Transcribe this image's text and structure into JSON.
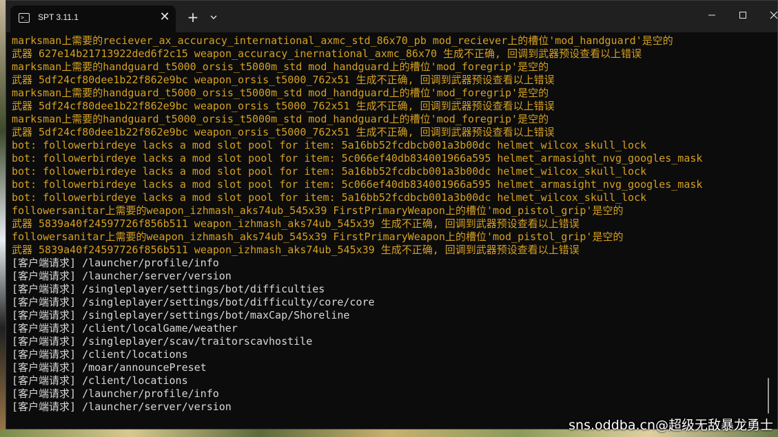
{
  "window": {
    "tab_title": "SPT 3.11.1",
    "tab_icon": "terminal-icon",
    "close_tab_label": "✕",
    "new_tab_label": "+"
  },
  "colors": {
    "warning": "#d6a022",
    "info": "#d8d8d8",
    "background": "#0c0c0c"
  },
  "console": {
    "lines": [
      {
        "type": "warn",
        "text": "marksman上需要的reciever_ax_accuracy_international_axmc_std_86x70_pb mod_reciever上的槽位'mod_handguard'是空的"
      },
      {
        "type": "warn",
        "text": "武器 627e14b21713922ded6f2c15 weapon_accuracy_inernational_axmc_86x70 生成不正确, 回调到武器预设查看以上错误"
      },
      {
        "type": "warn",
        "text": "marksman上需要的handguard_t5000_orsis_t5000m_std mod_handguard上的槽位'mod_foregrip'是空的"
      },
      {
        "type": "warn",
        "text": "武器 5df24cf80dee1b22f862e9bc weapon_orsis_t5000_762x51 生成不正确, 回调到武器预设查看以上错误"
      },
      {
        "type": "warn",
        "text": "marksman上需要的handguard_t5000_orsis_t5000m_std mod_handguard上的槽位'mod_foregrip'是空的"
      },
      {
        "type": "warn",
        "text": "武器 5df24cf80dee1b22f862e9bc weapon_orsis_t5000_762x51 生成不正确, 回调到武器预设查看以上错误"
      },
      {
        "type": "warn",
        "text": "marksman上需要的handguard_t5000_orsis_t5000m_std mod_handguard上的槽位'mod_foregrip'是空的"
      },
      {
        "type": "warn",
        "text": "武器 5df24cf80dee1b22f862e9bc weapon_orsis_t5000_762x51 生成不正确, 回调到武器预设查看以上错误"
      },
      {
        "type": "warn",
        "text": "bot: followerbirdeye lacks a mod slot pool for item: 5a16bb52fcdbcb001a3b00dc helmet_wilcox_skull_lock"
      },
      {
        "type": "warn",
        "text": "bot: followerbirdeye lacks a mod slot pool for item: 5c066ef40db834001966a595 helmet_armasight_nvg_googles_mask"
      },
      {
        "type": "warn",
        "text": "bot: followerbirdeye lacks a mod slot pool for item: 5a16bb52fcdbcb001a3b00dc helmet_wilcox_skull_lock"
      },
      {
        "type": "warn",
        "text": "bot: followerbirdeye lacks a mod slot pool for item: 5c066ef40db834001966a595 helmet_armasight_nvg_googles_mask"
      },
      {
        "type": "warn",
        "text": "bot: followerbirdeye lacks a mod slot pool for item: 5a16bb52fcdbcb001a3b00dc helmet_wilcox_skull_lock"
      },
      {
        "type": "warn",
        "text": "followersanitar上需要的weapon_izhmash_aks74ub_545x39 FirstPrimaryWeapon上的槽位'mod_pistol_grip'是空的"
      },
      {
        "type": "warn",
        "text": "武器 5839a40f24597726f856b511 weapon_izhmash_aks74ub_545x39 生成不正确, 回调到武器预设查看以上错误"
      },
      {
        "type": "warn",
        "text": "followersanitar上需要的weapon_izhmash_aks74ub_545x39 FirstPrimaryWeapon上的槽位'mod_pistol_grip'是空的"
      },
      {
        "type": "warn",
        "text": "武器 5839a40f24597726f856b511 weapon_izhmash_aks74ub_545x39 生成不正确, 回调到武器预设查看以上错误"
      },
      {
        "type": "info",
        "text": "[客户端请求] /launcher/profile/info"
      },
      {
        "type": "info",
        "text": "[客户端请求] /launcher/server/version"
      },
      {
        "type": "info",
        "text": "[客户端请求] /singleplayer/settings/bot/difficulties"
      },
      {
        "type": "info",
        "text": "[客户端请求] /singleplayer/settings/bot/difficulty/core/core"
      },
      {
        "type": "info",
        "text": "[客户端请求] /singleplayer/settings/bot/maxCap/Shoreline"
      },
      {
        "type": "info",
        "text": "[客户端请求] /client/localGame/weather"
      },
      {
        "type": "info",
        "text": "[客户端请求] /singleplayer/scav/traitorscavhostile"
      },
      {
        "type": "info",
        "text": "[客户端请求] /client/locations"
      },
      {
        "type": "info",
        "text": "[客户端请求] /moar/announcePreset"
      },
      {
        "type": "info",
        "text": "[客户端请求] /client/locations"
      },
      {
        "type": "info",
        "text": "[客户端请求] /launcher/profile/info"
      },
      {
        "type": "info",
        "text": "[客户端请求] /launcher/server/version"
      }
    ]
  },
  "watermark": "sns.oddba.cn@超级无敌暴龙勇士"
}
